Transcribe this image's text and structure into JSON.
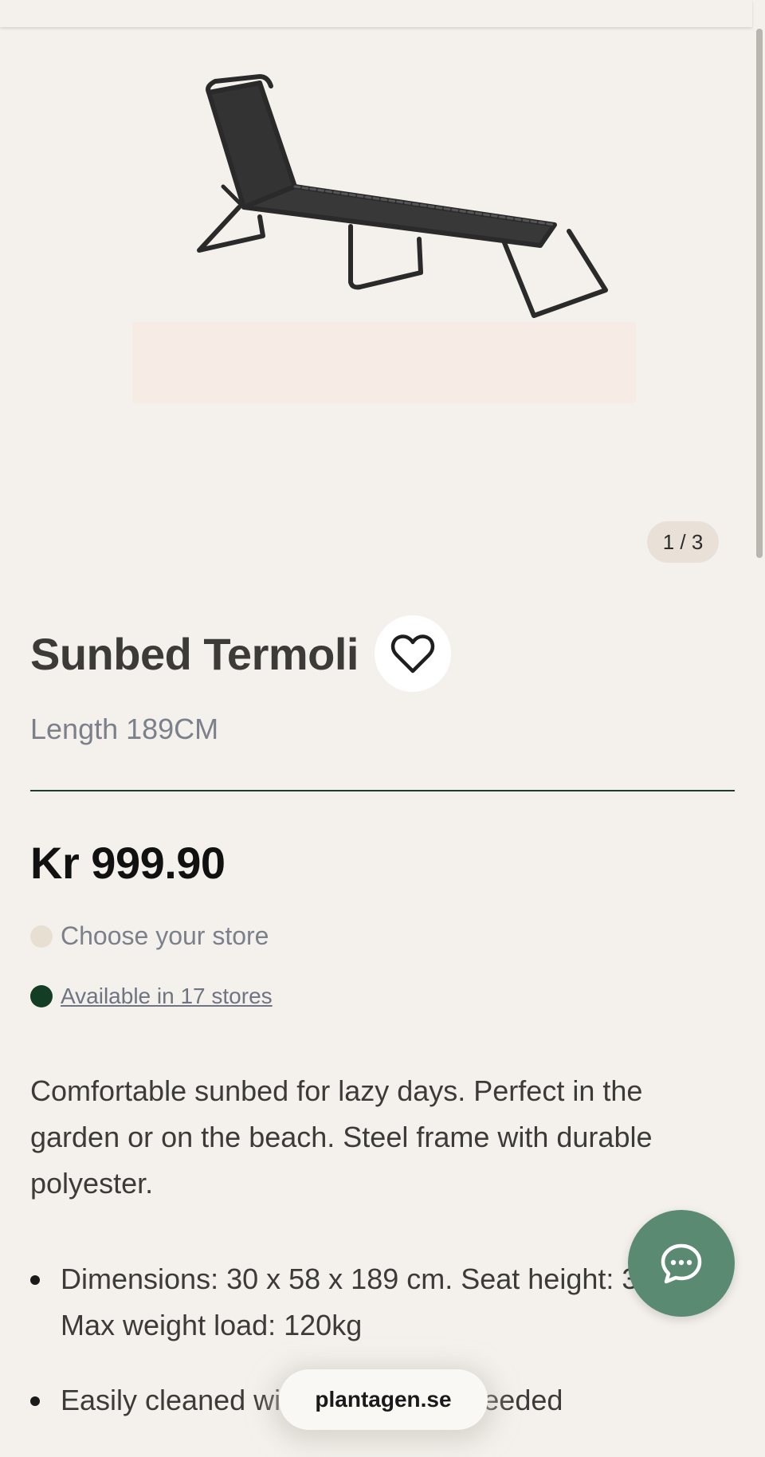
{
  "gallery": {
    "counter": "1 / 3",
    "image_alt": "sunbed-image"
  },
  "product": {
    "title": "Sunbed Termoli",
    "subtitle": "Length 189CM",
    "price": "Kr 999.90"
  },
  "store": {
    "choose_label": "Choose your store",
    "availability_label": "Available in 17 stores",
    "available_color": "#143d26"
  },
  "description": "Comfortable sunbed for lazy days. Perfect in the garden or on the beach. Steel frame with durable polyester.",
  "features": [
    "Dimensions: 30 x 58 x 189 cm. Seat height: 32",
    "Max weight load: 120kg",
    "Easily cleaned with water when needed"
  ],
  "browser": {
    "url": "plantagen.se"
  },
  "icons": {
    "favorite": "heart-icon",
    "chat": "chat-bubble-icon"
  },
  "colors": {
    "background": "#f4f1ec",
    "accent_green": "#5b8a73",
    "divider": "#1f3d2c"
  }
}
